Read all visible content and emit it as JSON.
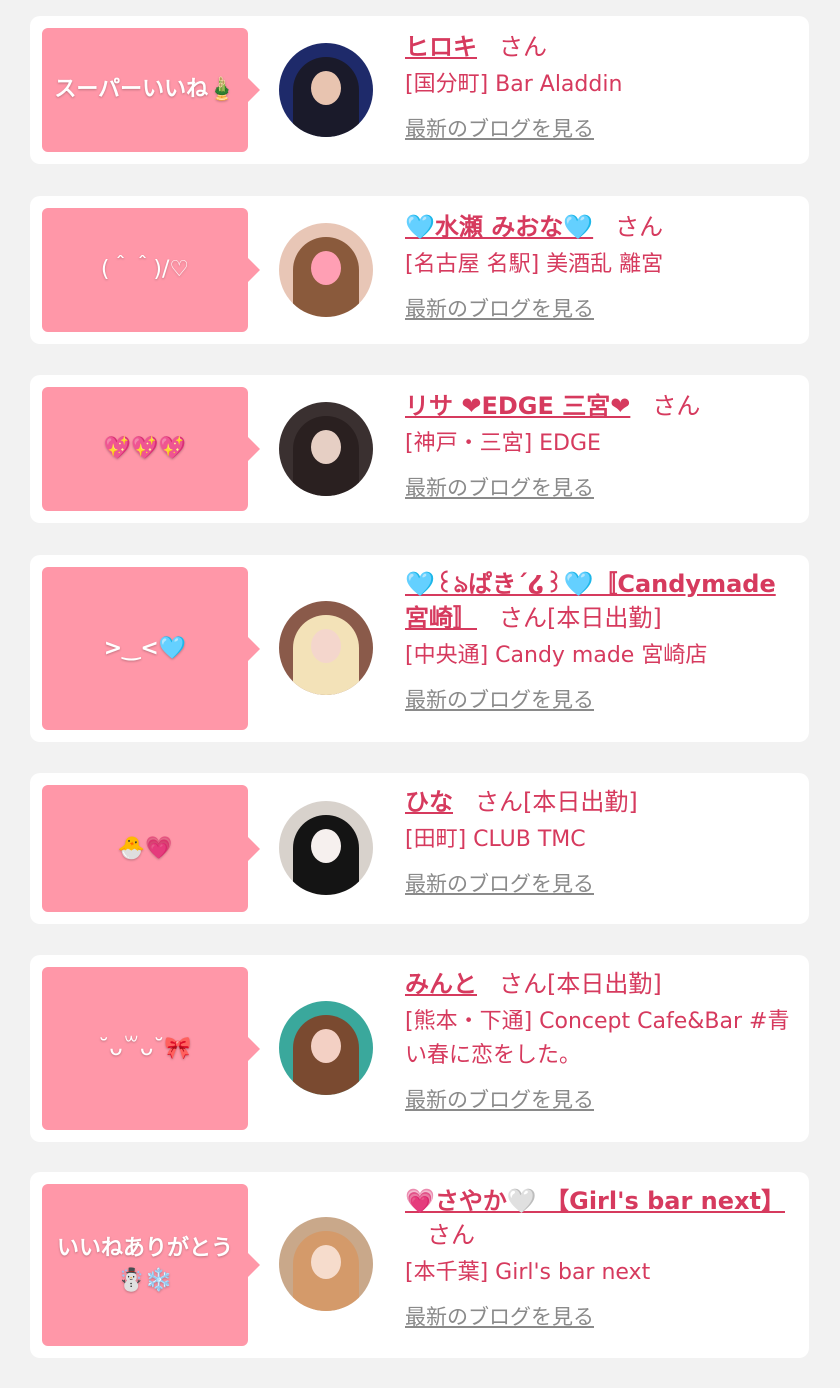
{
  "entries": [
    {
      "bubble": "スーパーいいね🎍",
      "name": "ヒロキ",
      "suffix": "さん",
      "status": "",
      "shop": "[国分町] Bar Aladdin",
      "blog_link": "最新のブログを見る",
      "avatar_colors": {
        "bg": "#1e2a6a",
        "hair": "#1a1a2a",
        "face": "#e8c4b0"
      }
    },
    {
      "bubble": "(＾＾)/♡",
      "name": "🩵水瀬 みおな🩵",
      "suffix": "さん",
      "status": "",
      "shop": "[名古屋 名駅] 美酒乱 離宮",
      "blog_link": "最新のブログを見る",
      "avatar_colors": {
        "bg": "#e8c6b6",
        "hair": "#8a5a3c",
        "face": "#ff9fb4"
      }
    },
    {
      "bubble": "💖💖💖",
      "name": "リサ ❤EDGE 三宮❤",
      "suffix": "さん",
      "status": "",
      "shop": "[神戸・三宮] EDGE",
      "blog_link": "最新のブログを見る",
      "avatar_colors": {
        "bg": "#3a3030",
        "hair": "#2a2020",
        "face": "#e6cfc4"
      }
    },
    {
      "bubble": ">‿<🩵",
      "name": "🩵꒰ঌぱきˊ໒꒱🩵〚Candymade宮崎〛",
      "suffix": "さん",
      "status": "[本日出勤]",
      "shop": "[中央通] Candy made 宮崎店",
      "blog_link": "最新のブログを見る",
      "avatar_colors": {
        "bg": "#8a5a4a",
        "hair": "#f3e2b8",
        "face": "#f4d6cc"
      }
    },
    {
      "bubble": "🐣💗",
      "name": "ひな",
      "suffix": "さん",
      "status": "[本日出勤]",
      "shop": "[田町] CLUB TMC",
      "blog_link": "最新のブログを見る",
      "avatar_colors": {
        "bg": "#d8d2cc",
        "hair": "#141414",
        "face": "#f6f0ee"
      }
    },
    {
      "bubble": "˘ᴗ꒳ᴗ˘🎀",
      "name": "みんと",
      "suffix": "さん",
      "status": "[本日出勤]",
      "shop": "[熊本・下通] Concept Cafe&Bar #青い春に恋をした。",
      "blog_link": "最新のブログを見る",
      "avatar_colors": {
        "bg": "#3aa89c",
        "hair": "#7a4a30",
        "face": "#f3d0c4"
      }
    },
    {
      "bubble": "いいねありがとう\n☃️❄️",
      "name": "💗さやか🤍 【Girl's bar next】",
      "suffix": "さん",
      "status": "",
      "shop": "[本千葉] Girl's bar next",
      "blog_link": "最新のブログを見る",
      "avatar_colors": {
        "bg": "#c9a88a",
        "hair": "#d49a6a",
        "face": "#f6dccc"
      }
    }
  ]
}
